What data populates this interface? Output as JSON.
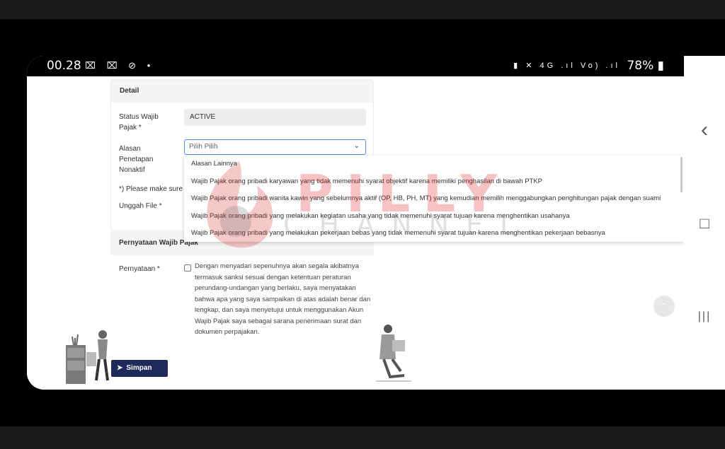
{
  "status_bar": {
    "time": "00.28",
    "left_icons": "⌧ ⌧ ⊘ •",
    "right_icons": "▮ ✕ 4G .ıl Vo) .ıl",
    "battery": "78%"
  },
  "detail": {
    "header": "Detail",
    "status_label": "Status Wajib Pajak *",
    "status_value": "ACTIVE",
    "reason_label": "Alasan Penetapan Nonaktif",
    "reason_placeholder": "Pilih Pilih",
    "note_partial": "*) Please make sure",
    "upload_label": "Unggah File *"
  },
  "dropdown": {
    "options": [
      "Alasan Lainnya",
      "Wajib Pajak orang pribadi karyawan yang tidak memenuhi syarat objektif karena memiliki penghasilan di bawah PTKP",
      "Wajib Pajak orang pribadi wanita kawin yang sebelumnya aktif (OP, HB, PH, MT) yang kemudian memilih menggabungkan penghitungan pajak dengan suami",
      "Wajib Pajak orang pribadi yang melakukan kegiatan usaha yang tidak memenuhi syarat tujuan karena menghentikan usahanya",
      "Wajib Pajak orang pribadi yang melakukan pekerjaan bebas yang tidak memenuhi syarat tujuan karena menghentikan pekerjaan bebasnya"
    ]
  },
  "statement": {
    "header": "Pernyataan Wajib Pajak",
    "label": "Pernyataan *",
    "text": "Dengan menyadari sepenuhnya akan segala akibatnya termasuk sanksi sesuai dengan ketentuan peraturan perundang-undangan yang berlaku, saya menyatakan bahwa apa yang saya sampaikan di atas adalah benar dan lengkap, dan saya menyetujui untuk menggunakan Akun Wajib Pajak saya sebagai sarana penerimaan surat dan dokumen perpajakan."
  },
  "actions": {
    "save_label": "Simpan"
  },
  "watermark": {
    "line1": "PILLY",
    "line2": "CHANNEL"
  },
  "nav": {
    "back_glyph": "‹",
    "home_glyph": "□",
    "recents_glyph": "|||",
    "scroll_top_glyph": "⌃"
  },
  "colors": {
    "accent": "#4a90d9",
    "button": "#1e2a5a",
    "header_bg": "#f4f5f7"
  }
}
